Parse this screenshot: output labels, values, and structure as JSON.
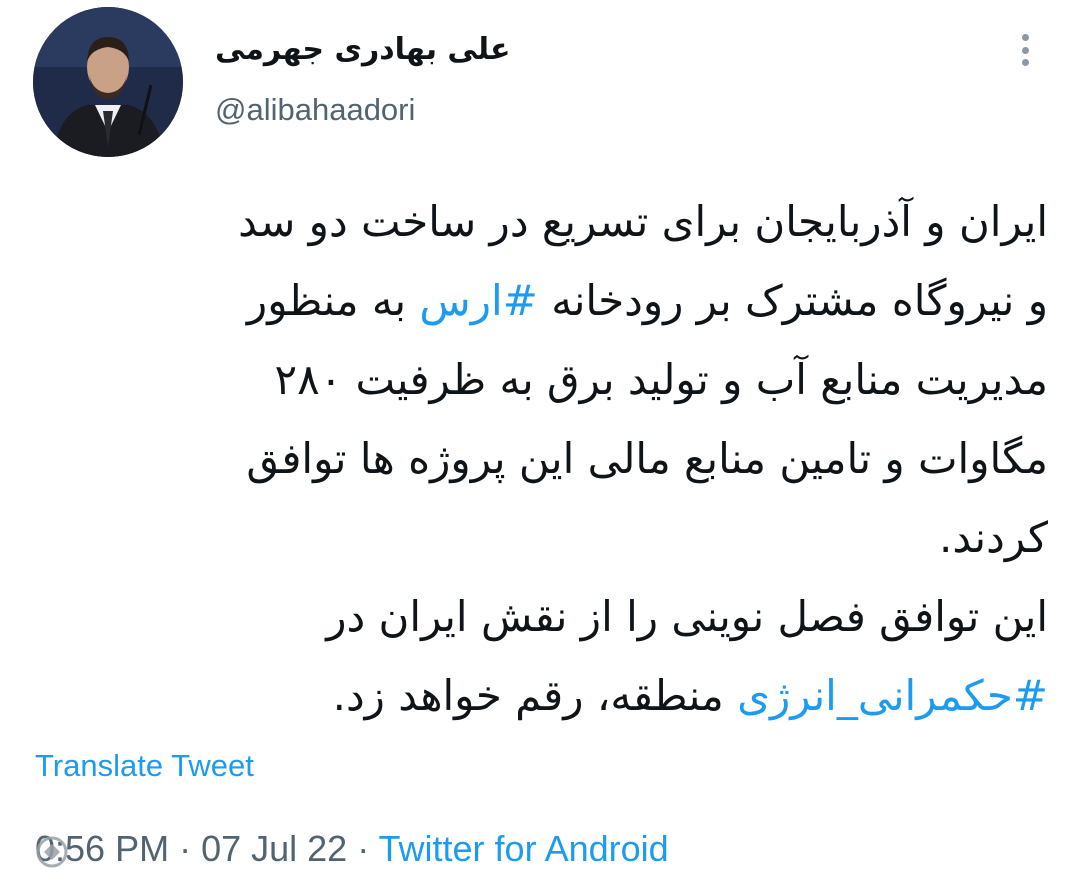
{
  "author": {
    "display_name": "علی بهادری جهرمی",
    "handle": "@alibahaadori"
  },
  "tweet": {
    "lines": [
      {
        "parts": [
          {
            "text": "ایران و آذربایجان برای تسریع در ساخت دو سد",
            "type": "text"
          }
        ]
      },
      {
        "parts": [
          {
            "text": "و نیروگاه مشترک بر رودخانه ",
            "type": "text"
          },
          {
            "text": "#ارس",
            "type": "hashtag"
          },
          {
            "text": " به منظور",
            "type": "text"
          }
        ]
      },
      {
        "parts": [
          {
            "text": "مدیریت منابع آب و تولید برق به ظرفیت ۲۸۰",
            "type": "text"
          }
        ]
      },
      {
        "parts": [
          {
            "text": "مگاوات و تامین منابع مالی این پروژه ها توافق",
            "type": "text"
          }
        ]
      },
      {
        "parts": [
          {
            "text": "کردند.",
            "type": "text"
          }
        ]
      },
      {
        "parts": [
          {
            "text": "این توافق فصل نوینی را از نقش ایران در",
            "type": "text"
          }
        ]
      },
      {
        "parts": [
          {
            "text": "#حکمرانی_انرژی",
            "type": "hashtag"
          },
          {
            "text": " منطقه، رقم خواهد زد.",
            "type": "text"
          }
        ]
      }
    ]
  },
  "translate_label": "Translate Tweet",
  "meta": {
    "time": "0:56 PM",
    "separator": " · ",
    "date": "07 Jul 22",
    "source": "Twitter for Android"
  },
  "colors": {
    "link": "#1d9bf0",
    "secondary": "#536471",
    "text": "#0f1419"
  },
  "icons": {
    "more": "more-vertical-icon",
    "watermark": "watermark-logo"
  }
}
